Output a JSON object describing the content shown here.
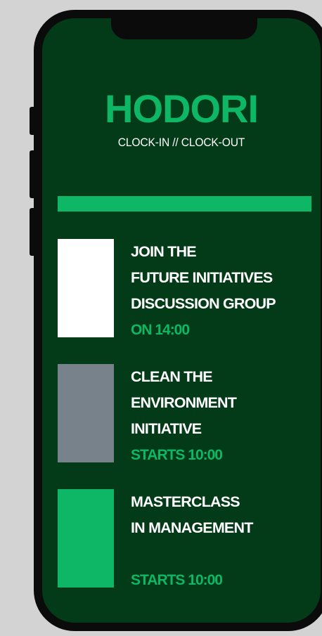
{
  "app": {
    "logo_text": "HODORI",
    "tagline": "CLOCK-IN // CLOCK-OUT"
  },
  "colors": {
    "background": "#d3d3d3",
    "phone_frame": "#0b0b0b",
    "screen": "#033a17",
    "accent": "#0db765",
    "text": "#ffffff"
  },
  "events": [
    {
      "thumb_color": "#ffffff",
      "title_lines": [
        "JOIN THE",
        "FUTURE INITIATIVES",
        "DISCUSSION GROUP"
      ],
      "time": "ON 14:00"
    },
    {
      "thumb_color": "#78828a",
      "title_lines": [
        "CLEAN THE",
        "ENVIRONMENT",
        "INITIATIVE"
      ],
      "time": "STARTS 10:00"
    },
    {
      "thumb_color": "#0db765",
      "title_lines": [
        "MASTERCLASS",
        "IN MANAGEMENT"
      ],
      "time": "STARTS 10:00"
    }
  ]
}
